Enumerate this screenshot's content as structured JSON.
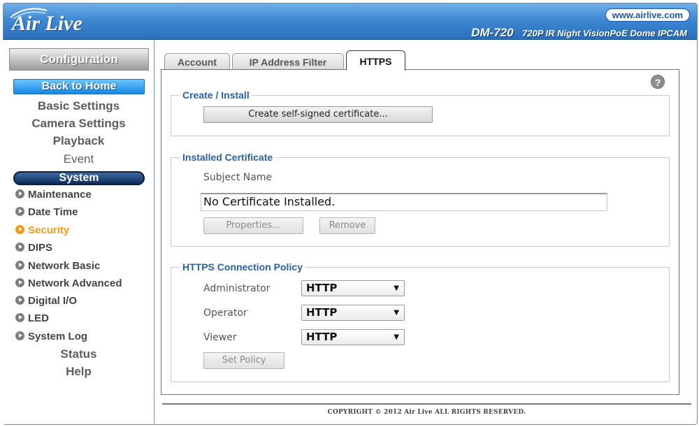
{
  "header": {
    "logo": "Air Live",
    "site": "www.airlive.com",
    "model": "DM-720",
    "model_desc": "720P IR Night VisionPoE Dome IPCAM"
  },
  "sidebar": {
    "config_title": "Configuration",
    "back_home": "Back to Home",
    "main_items": [
      "Basic Settings",
      "Camera Settings",
      "Playback",
      "Event"
    ],
    "system_label": "System",
    "sub_items": [
      {
        "label": "Maintenance",
        "active": false
      },
      {
        "label": "Date Time",
        "active": false
      },
      {
        "label": "Security",
        "active": true
      },
      {
        "label": "DIPS",
        "active": false
      },
      {
        "label": "Network Basic",
        "active": false
      },
      {
        "label": "Network Advanced",
        "active": false
      },
      {
        "label": "Digital I/O",
        "active": false
      },
      {
        "label": "LED",
        "active": false
      },
      {
        "label": "System Log",
        "active": false
      }
    ],
    "bottom_items": [
      "Status",
      "Help"
    ]
  },
  "tabs": [
    {
      "label": "Account",
      "active": false
    },
    {
      "label": "IP Address Filter",
      "active": false
    },
    {
      "label": "HTTPS",
      "active": true
    }
  ],
  "create_install": {
    "legend": "Create / Install",
    "create_button": "Create self-signed certificate..."
  },
  "installed_cert": {
    "legend": "Installed Certificate",
    "subject_label": "Subject Name",
    "subject_value": "No Certificate Installed.",
    "properties_button": "Properties...",
    "remove_button": "Remove"
  },
  "policy": {
    "legend": "HTTPS Connection Policy",
    "rows": [
      {
        "label": "Administrator",
        "value": "HTTP"
      },
      {
        "label": "Operator",
        "value": "HTTP"
      },
      {
        "label": "Viewer",
        "value": "HTTP"
      }
    ],
    "set_button": "Set Policy"
  },
  "footer": "COPYRIGHT © 2012 Air Live ALL RIGHTS RESERVED.",
  "colors": {
    "header_blue": "#3f88d2",
    "legend_blue": "#2b5fa8",
    "active_orange": "#f29a1a",
    "system_navy": "#0e2c55"
  }
}
